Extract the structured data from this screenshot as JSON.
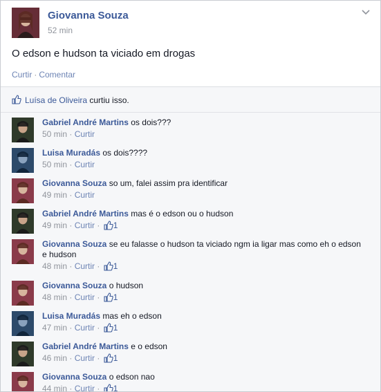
{
  "post": {
    "author": "Giovanna Souza",
    "time": "52 min",
    "text": "O edson e hudson ta viciado em drogas",
    "actions": {
      "like": "Curtir",
      "separator": "·",
      "comment": "Comentar"
    }
  },
  "likes": {
    "liker": "Luísa de Oliveira",
    "suffix": " curtiu isso."
  },
  "comments": [
    {
      "author": "Gabriel André Martins",
      "text": " os dois???",
      "time": "50 min",
      "like_label": "Curtir",
      "likes": ""
    },
    {
      "author": "Luisa Muradás",
      "text": " os dois????",
      "time": "50 min",
      "like_label": "Curtir",
      "likes": ""
    },
    {
      "author": "Giovanna Souza",
      "text": " so um, falei assim pra identificar",
      "time": "49 min",
      "like_label": "Curtir",
      "likes": ""
    },
    {
      "author": "Gabriel André Martins",
      "text": " mas é o edson ou o hudson",
      "time": "49 min",
      "like_label": "Curtir",
      "likes": "1"
    },
    {
      "author": "Giovanna Souza",
      "text": " se eu falasse o hudson ta viciado ngm ia ligar mas como eh o edson e hudson",
      "time": "48 min",
      "like_label": "Curtir",
      "likes": "1"
    },
    {
      "author": "Giovanna Souza",
      "text": " o hudson",
      "time": "48 min",
      "like_label": "Curtir",
      "likes": "1"
    },
    {
      "author": "Luisa Muradás",
      "text": " mas eh o edson",
      "time": "47 min",
      "like_label": "Curtir",
      "likes": "1"
    },
    {
      "author": "Gabriel André Martins",
      "text": " e o edson",
      "time": "46 min",
      "like_label": "Curtir",
      "likes": "1"
    },
    {
      "author": "Giovanna Souza",
      "text": " o edson nao",
      "time": "44 min",
      "like_label": "Curtir",
      "likes": "1"
    }
  ],
  "colors": {
    "link": "#3b5998",
    "muted": "#90949c",
    "background": "#f6f7f9"
  },
  "icons": {
    "post_menu": "chevron-down-icon",
    "like": "thumbs-up-icon"
  }
}
